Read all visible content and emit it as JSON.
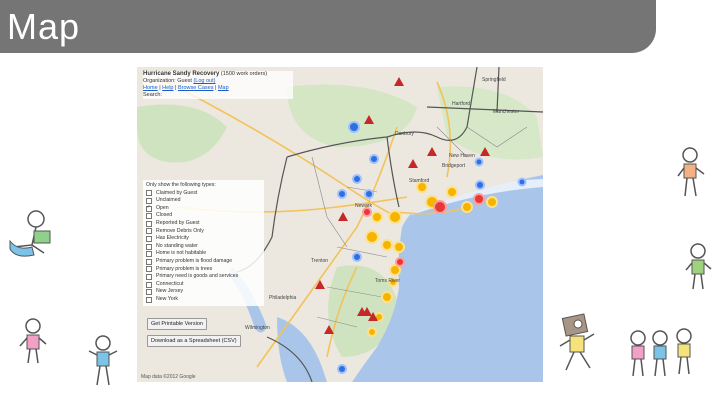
{
  "slide": {
    "title": "Map"
  },
  "map": {
    "app_title": "Hurricane Sandy Recovery",
    "app_subtitle": "(1500 work orders)",
    "org_line": "Organization: Guest",
    "logout_link": "(Log out)",
    "nav_links": [
      "Home",
      "Help",
      "Browse Cases",
      "Map"
    ],
    "search_label": "Search:",
    "filter_heading": "Only show the following types:",
    "filters": [
      {
        "label": "Claimed by Guest",
        "checked": false
      },
      {
        "label": "Unclaimed",
        "checked": false
      },
      {
        "label": "Open",
        "checked": true
      },
      {
        "label": "Closed",
        "checked": false
      },
      {
        "label": "Reported by Guest",
        "checked": false
      },
      {
        "label": "Remove Debris Only",
        "checked": false
      },
      {
        "label": "Has Electricity",
        "checked": false
      },
      {
        "label": "No standing water",
        "checked": false
      },
      {
        "label": "Home is not habitable",
        "checked": false
      },
      {
        "label": "Primary problem is flood damage",
        "checked": false
      },
      {
        "label": "Primary problem is trees",
        "checked": false
      },
      {
        "label": "Primary need is goods and services",
        "checked": false
      },
      {
        "label": "Connecticut",
        "checked": false
      },
      {
        "label": "New Jersey",
        "checked": false
      },
      {
        "label": "New York",
        "checked": false
      }
    ],
    "printable_button": "Get Printable Version",
    "download_button": "Download as a Spreadsheet (CSV)",
    "footer": "Map data ©2012 Google",
    "place_labels": [
      "Springfield",
      "Hartford",
      "Manchester",
      "New Haven",
      "Bridgeport",
      "Stamford",
      "Newark",
      "Trenton",
      "Philadelphia",
      "Toms River",
      "Wilmington",
      "Danbury"
    ],
    "colors": {
      "cluster_blue": "#2f6fe0",
      "cluster_yellow": "#f4b400",
      "cluster_red": "#e53935",
      "marker_red": "#c62828"
    }
  }
}
